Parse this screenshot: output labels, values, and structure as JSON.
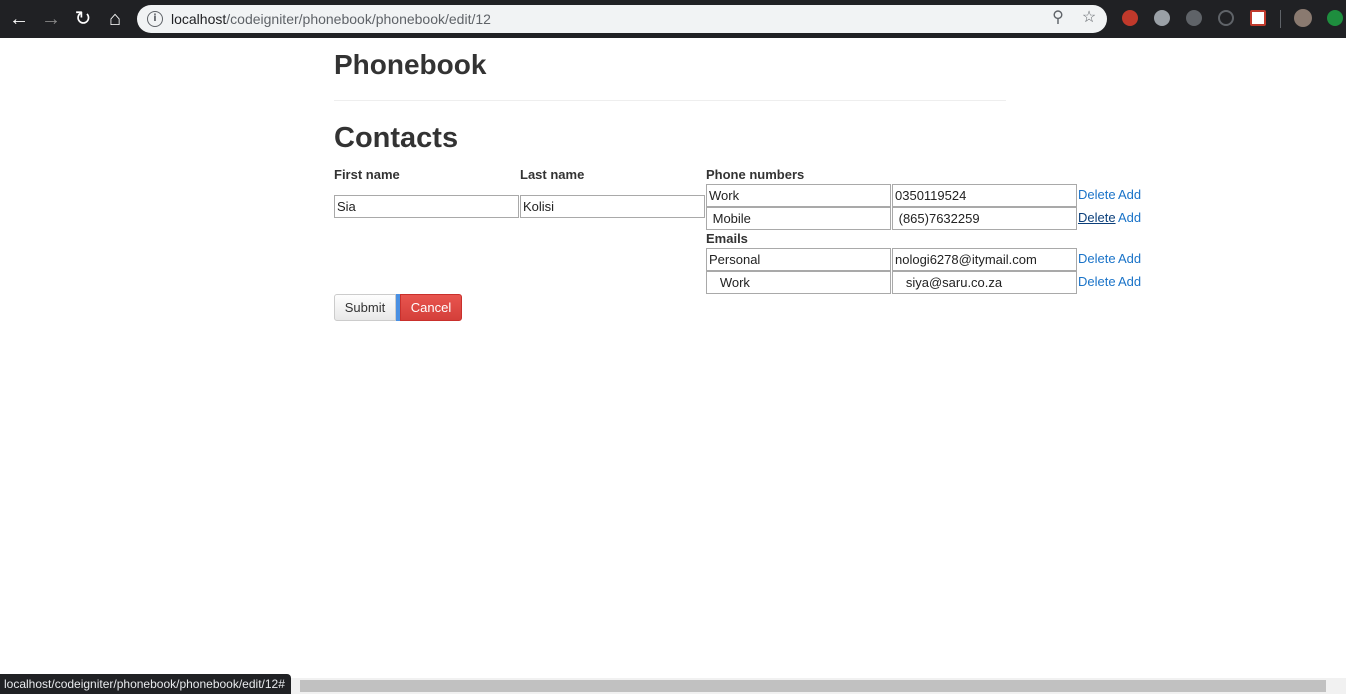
{
  "browser": {
    "url_host": "localhost",
    "url_path": "/codeigniter/phonebook/phonebook/edit/12",
    "status_url": "localhost/codeigniter/phonebook/phonebook/edit/12#"
  },
  "page": {
    "title": "Phonebook",
    "section": "Contacts"
  },
  "form": {
    "first_name_label": "First name",
    "last_name_label": "Last name",
    "first_name_value": "Sia",
    "last_name_value": "Kolisi",
    "phone_label": "Phone numbers",
    "emails_label": "Emails",
    "phones": [
      {
        "type": "Work",
        "value": "0350119524"
      },
      {
        "type": " Mobile",
        "value": " (865)7632259"
      }
    ],
    "emails": [
      {
        "type": "Personal",
        "value": "nologi6278@itymail.com"
      },
      {
        "type": "   Work",
        "value": "   siya@saru.co.za"
      }
    ],
    "delete_label": "Delete",
    "add_label": "Add",
    "submit_label": "Submit",
    "cancel_label": "Cancel"
  },
  "colors": {
    "link": "#1a73c8",
    "cancel": "#d9534f",
    "chrome": "#202124"
  }
}
